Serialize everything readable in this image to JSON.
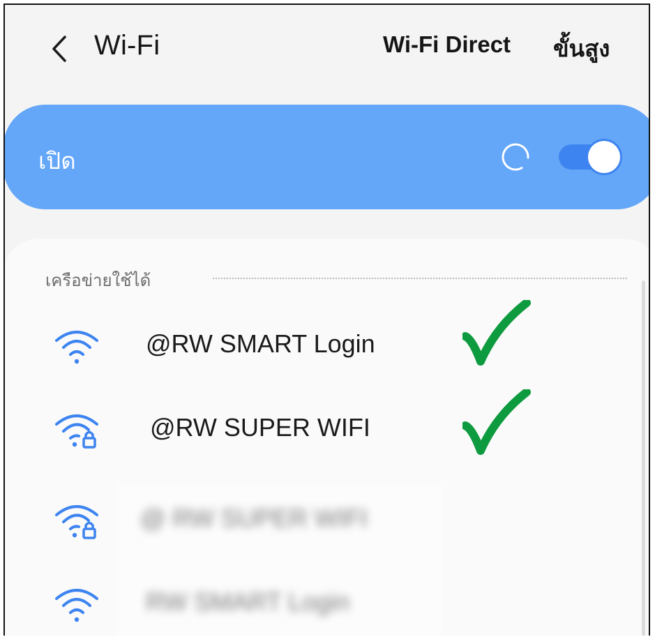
{
  "header": {
    "title": "Wi-Fi",
    "direct_label": "Wi-Fi Direct",
    "advanced_label": "ขั้นสูง"
  },
  "master": {
    "label": "เปิด",
    "toggle_on": true
  },
  "networks_section": {
    "title": "เครือข่ายใช้ได้"
  },
  "networks": [
    {
      "name": "@RW SMART Login",
      "locked": false,
      "icon": "wifi-icon"
    },
    {
      "name": "@RW SUPER WIFI",
      "locked": true,
      "icon": "wifi-lock-icon"
    },
    {
      "name": "@ RW SUPER WIFI",
      "locked": true,
      "icon": "wifi-lock-icon",
      "blurred": true
    },
    {
      "name": "RW SMART Login",
      "locked": false,
      "icon": "wifi-icon",
      "blurred": true
    }
  ],
  "colors": {
    "accent": "#64a6f8",
    "toggle": "#3d84f0",
    "wifi_icon": "#3d84f0",
    "check": "#0e9a3e"
  }
}
